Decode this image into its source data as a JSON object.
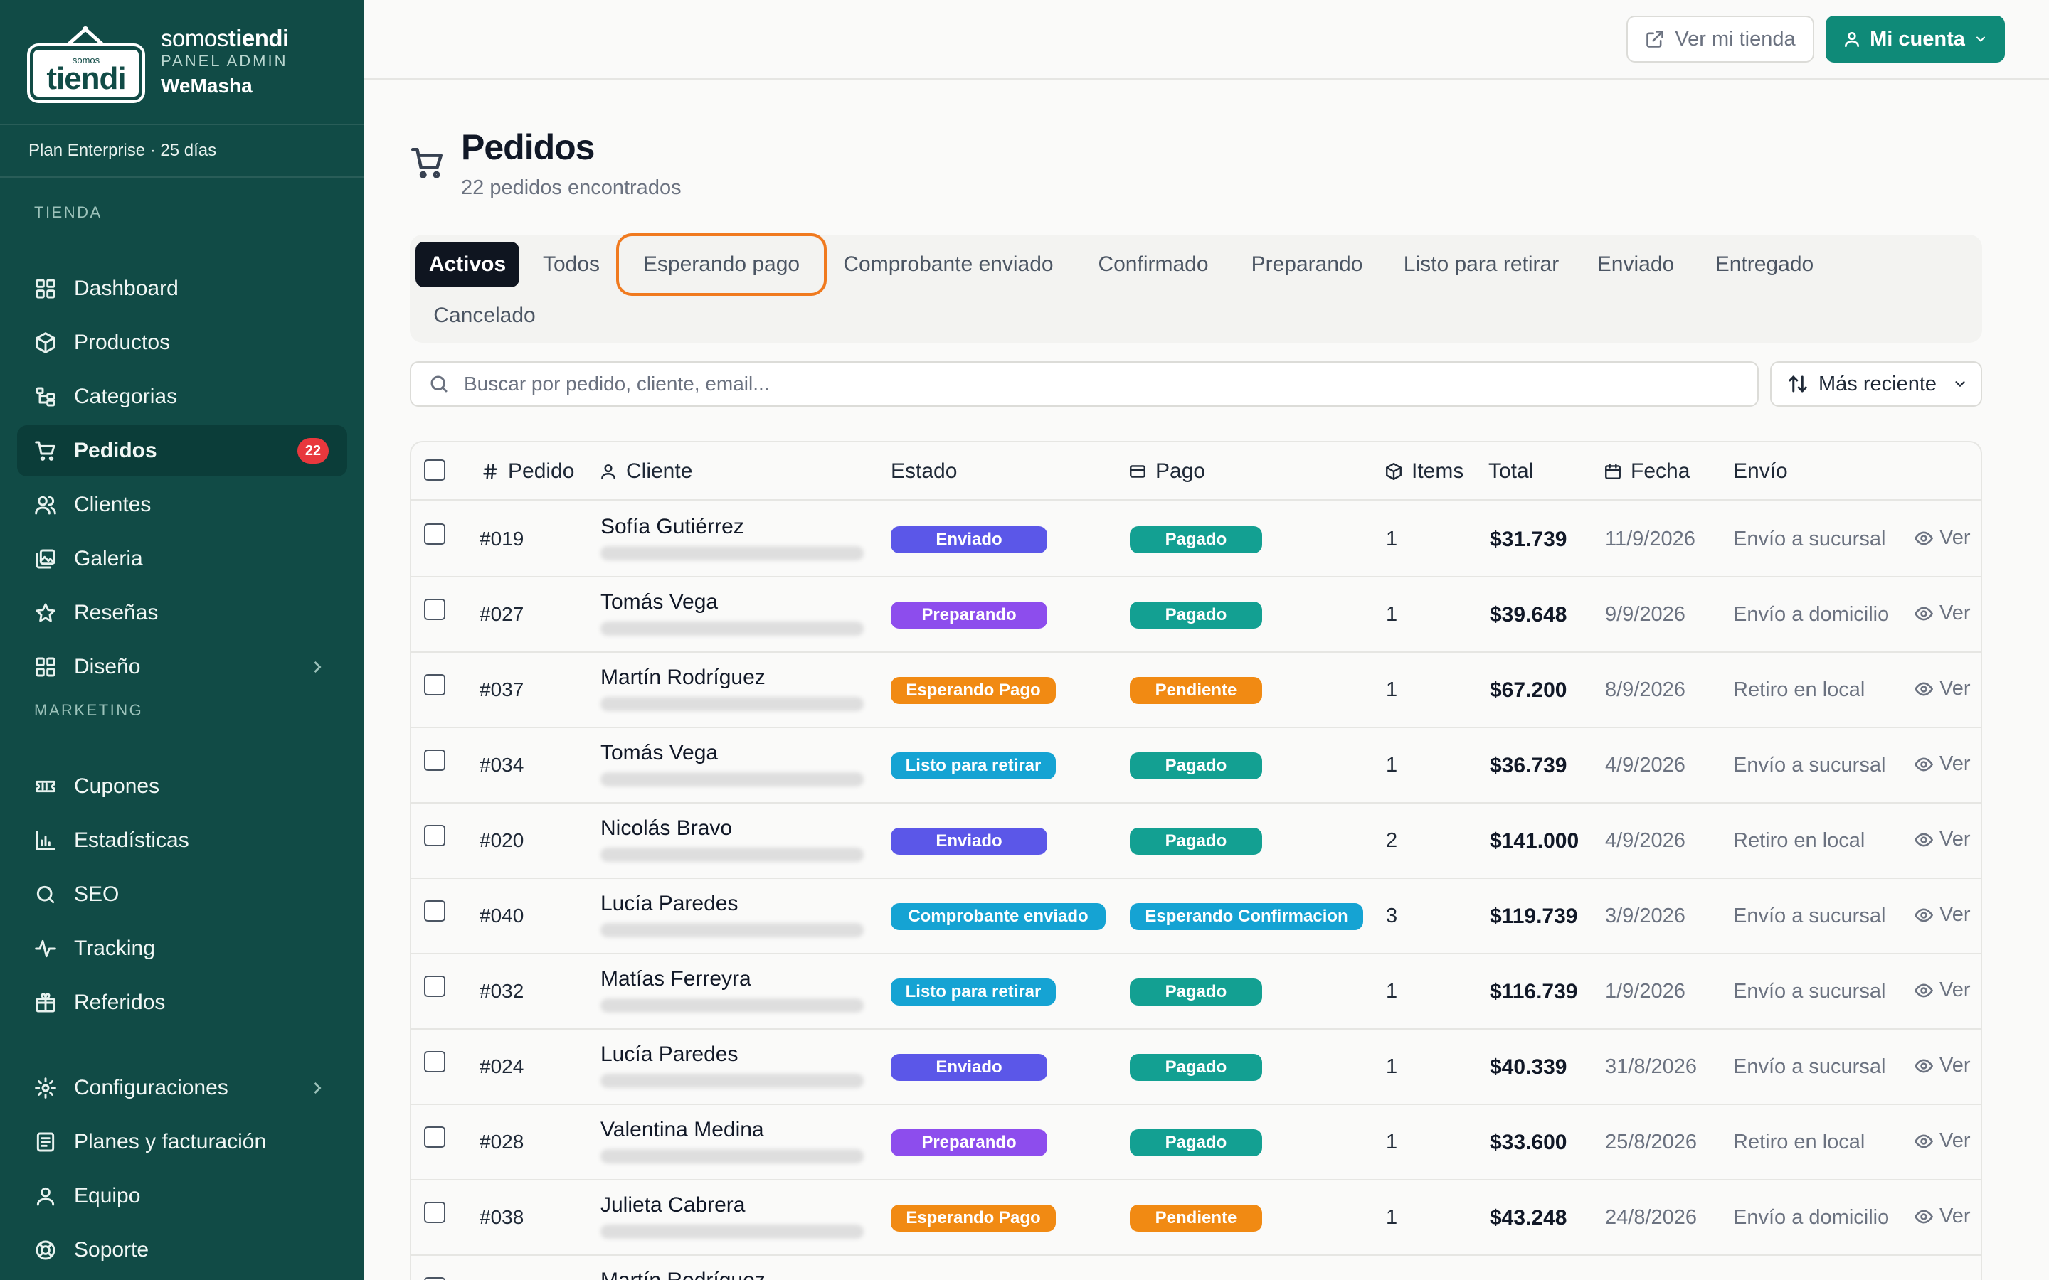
{
  "brand": {
    "logo_small": "somos",
    "logo_big": "tiendi",
    "name_light": "somos",
    "name_bold": "tiendi",
    "subtitle": "PANEL ADMIN",
    "store": "WeMasha"
  },
  "plan": "Plan Enterprise · 25 días",
  "sidebar": {
    "section_store": "TIENDA",
    "section_marketing": "MARKETING",
    "items": [
      {
        "label": "Dashboard",
        "icon": "grid-icon"
      },
      {
        "label": "Productos",
        "icon": "box-icon"
      },
      {
        "label": "Categorias",
        "icon": "tree-icon"
      },
      {
        "label": "Pedidos",
        "icon": "cart-icon",
        "badge": "22"
      },
      {
        "label": "Clientes",
        "icon": "users-icon"
      },
      {
        "label": "Galeria",
        "icon": "gallery-icon"
      },
      {
        "label": "Reseñas",
        "icon": "star-icon"
      },
      {
        "label": "Diseño",
        "icon": "layout-icon"
      },
      {
        "label": "Cupones",
        "icon": "ticket-icon"
      },
      {
        "label": "Estadísticas",
        "icon": "bar-chart-icon"
      },
      {
        "label": "SEO",
        "icon": "search-icon"
      },
      {
        "label": "Tracking",
        "icon": "activity-icon"
      },
      {
        "label": "Referidos",
        "icon": "gift-icon"
      },
      {
        "label": "Configuraciones",
        "icon": "gear-icon"
      },
      {
        "label": "Planes y facturación",
        "icon": "receipt-icon"
      },
      {
        "label": "Equipo",
        "icon": "team-icon"
      },
      {
        "label": "Soporte",
        "icon": "lifebuoy-icon"
      }
    ]
  },
  "topbar": {
    "view_store": "Ver mi tienda",
    "account": "Mi cuenta"
  },
  "header": {
    "title": "Pedidos",
    "subtitle": "22 pedidos encontrados"
  },
  "tabs": [
    "Activos",
    "Todos",
    "Esperando pago",
    "Comprobante enviado",
    "Confirmado",
    "Preparando",
    "Listo para retirar",
    "Enviado",
    "Entregado",
    "Cancelado"
  ],
  "search": {
    "placeholder": "Buscar por pedido, cliente, email..."
  },
  "sort": {
    "label": "Más reciente"
  },
  "table": {
    "headers": {
      "order": "Pedido",
      "client": "Cliente",
      "status": "Estado",
      "payment": "Pago",
      "items": "Items",
      "total": "Total",
      "date": "Fecha",
      "shipping": "Envío"
    },
    "view_label": "Ver",
    "rows": [
      {
        "order": "#019",
        "client": "Sofía Gutiérrez",
        "status": "Enviado",
        "payment": "Pagado",
        "items": "1",
        "total": "$31.739",
        "date": "11/9/2026",
        "shipping": "Envío a sucursal"
      },
      {
        "order": "#027",
        "client": "Tomás Vega",
        "status": "Preparando",
        "payment": "Pagado",
        "items": "1",
        "total": "$39.648",
        "date": "9/9/2026",
        "shipping": "Envío a domicilio"
      },
      {
        "order": "#037",
        "client": "Martín Rodríguez",
        "status": "Esperando Pago",
        "payment": "Pendiente",
        "items": "1",
        "total": "$67.200",
        "date": "8/9/2026",
        "shipping": "Retiro en local"
      },
      {
        "order": "#034",
        "client": "Tomás Vega",
        "status": "Listo para retirar",
        "payment": "Pagado",
        "items": "1",
        "total": "$36.739",
        "date": "4/9/2026",
        "shipping": "Envío a sucursal"
      },
      {
        "order": "#020",
        "client": "Nicolás Bravo",
        "status": "Enviado",
        "payment": "Pagado",
        "items": "2",
        "total": "$141.000",
        "date": "4/9/2026",
        "shipping": "Retiro en local"
      },
      {
        "order": "#040",
        "client": "Lucía Paredes",
        "status": "Comprobante enviado",
        "payment": "Esperando Confirmacion",
        "items": "3",
        "total": "$119.739",
        "date": "3/9/2026",
        "shipping": "Envío a sucursal"
      },
      {
        "order": "#032",
        "client": "Matías Ferreyra",
        "status": "Listo para retirar",
        "payment": "Pagado",
        "items": "1",
        "total": "$116.739",
        "date": "1/9/2026",
        "shipping": "Envío a sucursal"
      },
      {
        "order": "#024",
        "client": "Lucía Paredes",
        "status": "Enviado",
        "payment": "Pagado",
        "items": "1",
        "total": "$40.339",
        "date": "31/8/2026",
        "shipping": "Envío a sucursal"
      },
      {
        "order": "#028",
        "client": "Valentina Medina",
        "status": "Preparando",
        "payment": "Pagado",
        "items": "1",
        "total": "$33.600",
        "date": "25/8/2026",
        "shipping": "Retiro en local"
      },
      {
        "order": "#038",
        "client": "Julieta Cabrera",
        "status": "Esperando Pago",
        "payment": "Pendiente",
        "items": "1",
        "total": "$43.248",
        "date": "24/8/2026",
        "shipping": "Envío a domicilio"
      },
      {
        "order": "",
        "client": "Martín Rodríguez",
        "status": "",
        "payment": "",
        "items": "",
        "total": "",
        "date": "",
        "shipping": ""
      }
    ]
  },
  "colors": {
    "sidebar_bg": "#114b46",
    "primary": "#0f8a78",
    "Enviado": "#5b57e8",
    "Preparando": "#8d4ded",
    "Esperando Pago": "#f18a13",
    "Listo para retirar": "#15a3d3",
    "Comprobante enviado": "#15a3d3",
    "Pagado": "#13a092",
    "Pendiente": "#f18a13",
    "Esperando Confirmacion": "#15a3d3",
    "highlight": "#f07a1f",
    "badge_red": "#e8383d"
  }
}
